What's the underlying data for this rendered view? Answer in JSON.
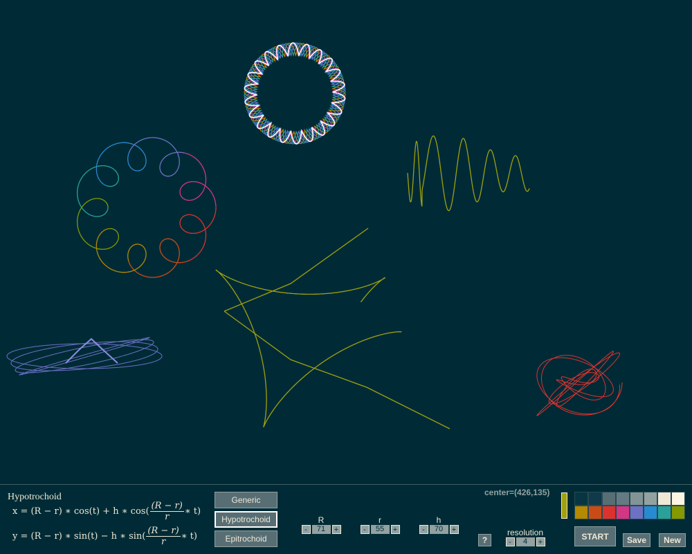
{
  "mode": {
    "title": "Hypotrochoid",
    "formula_x": {
      "lhs": "x = (R − r) ∗ cos(t) + h ∗ cos(",
      "num": "(R − r)",
      "den": "r",
      "rhs": "∗ t)"
    },
    "formula_y": {
      "lhs": "y = (R − r) ∗ sin(t) − h ∗ sin(",
      "num": "(R − r)",
      "den": "r",
      "rhs": "∗ t)"
    }
  },
  "mode_buttons": [
    {
      "label": "Generic",
      "active": false
    },
    {
      "label": "Hypotrochoid",
      "active": true
    },
    {
      "label": "Epitrochoid",
      "active": false
    }
  ],
  "params": {
    "R": {
      "label": "R",
      "value": "71"
    },
    "r": {
      "label": "r",
      "value": "55"
    },
    "h": {
      "label": "h",
      "value": "70"
    },
    "resolution": {
      "label": "resolution",
      "value": "4"
    }
  },
  "stepper": {
    "minus": "-",
    "plus": "+"
  },
  "help_label": "?",
  "center_readout": "center=(426,135)",
  "actions": {
    "start": "START",
    "save": "Save",
    "new": "New"
  },
  "current_color": "#a0a010",
  "palette": [
    "#073642",
    "#0f3a4a",
    "#586e75",
    "#657b83",
    "#839496",
    "#93a1a1",
    "#eee8d5",
    "#fdf6e3",
    "#b58900",
    "#cb4b16",
    "#dc322f",
    "#d33682",
    "#6c71c4",
    "#268bd2",
    "#2aa198",
    "#859900"
  ]
}
